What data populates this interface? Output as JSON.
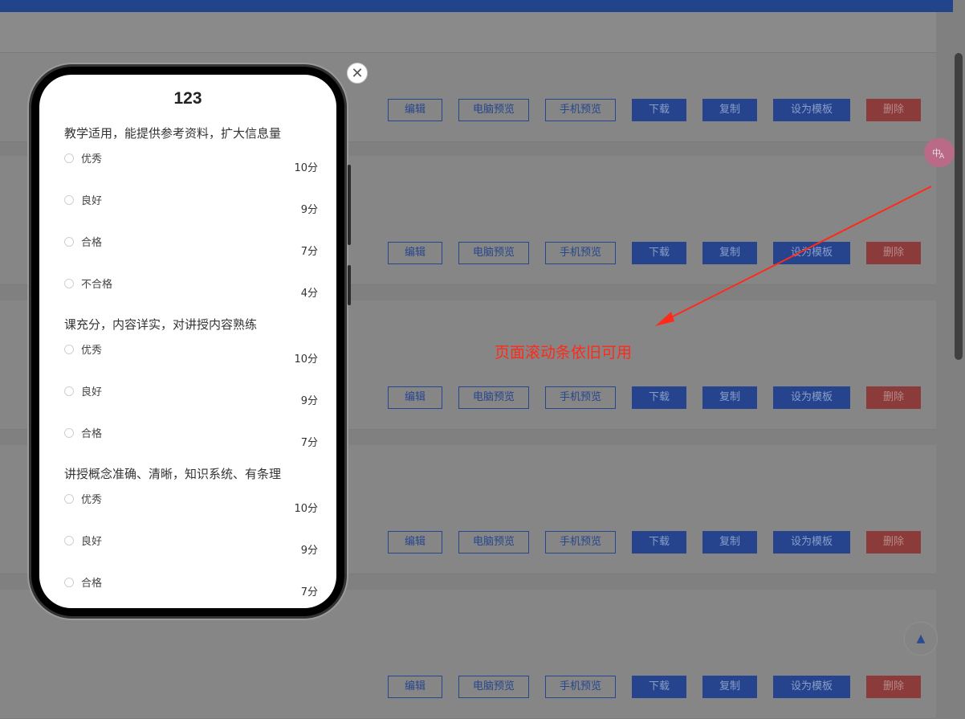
{
  "card_buttons": {
    "edit": "编辑",
    "pc_preview": "电脑预览",
    "mobile_preview": "手机预览",
    "download": "下载",
    "copy": "复制",
    "set_template": "设为模板",
    "delete": "删除"
  },
  "annotation": "页面滚动条依旧可用",
  "translate_icon_text": "Ѣ",
  "back_to_top_icon": "▲",
  "close_icon": "✕",
  "survey": {
    "title": "123",
    "questions": [
      {
        "text": "教学适用，能提供参考资料，扩大信息量",
        "options": [
          {
            "label": "优秀",
            "score": "10分"
          },
          {
            "label": "良好",
            "score": "9分"
          },
          {
            "label": "合格",
            "score": "7分"
          },
          {
            "label": "不合格",
            "score": "4分"
          }
        ]
      },
      {
        "text": "课充分，内容详实，对讲授内容熟练",
        "options": [
          {
            "label": "优秀",
            "score": "10分"
          },
          {
            "label": "良好",
            "score": "9分"
          },
          {
            "label": "合格",
            "score": "7分"
          }
        ]
      },
      {
        "text": "讲授概念准确、清晰，知识系统、有条理",
        "options": [
          {
            "label": "优秀",
            "score": "10分"
          },
          {
            "label": "良好",
            "score": "9分"
          },
          {
            "label": "合格",
            "score": "7分"
          }
        ]
      }
    ]
  },
  "colors": {
    "header": "#22448a",
    "primary": "#25448d",
    "danger": "#8c3b3b",
    "annotation": "#ff2a1a"
  }
}
